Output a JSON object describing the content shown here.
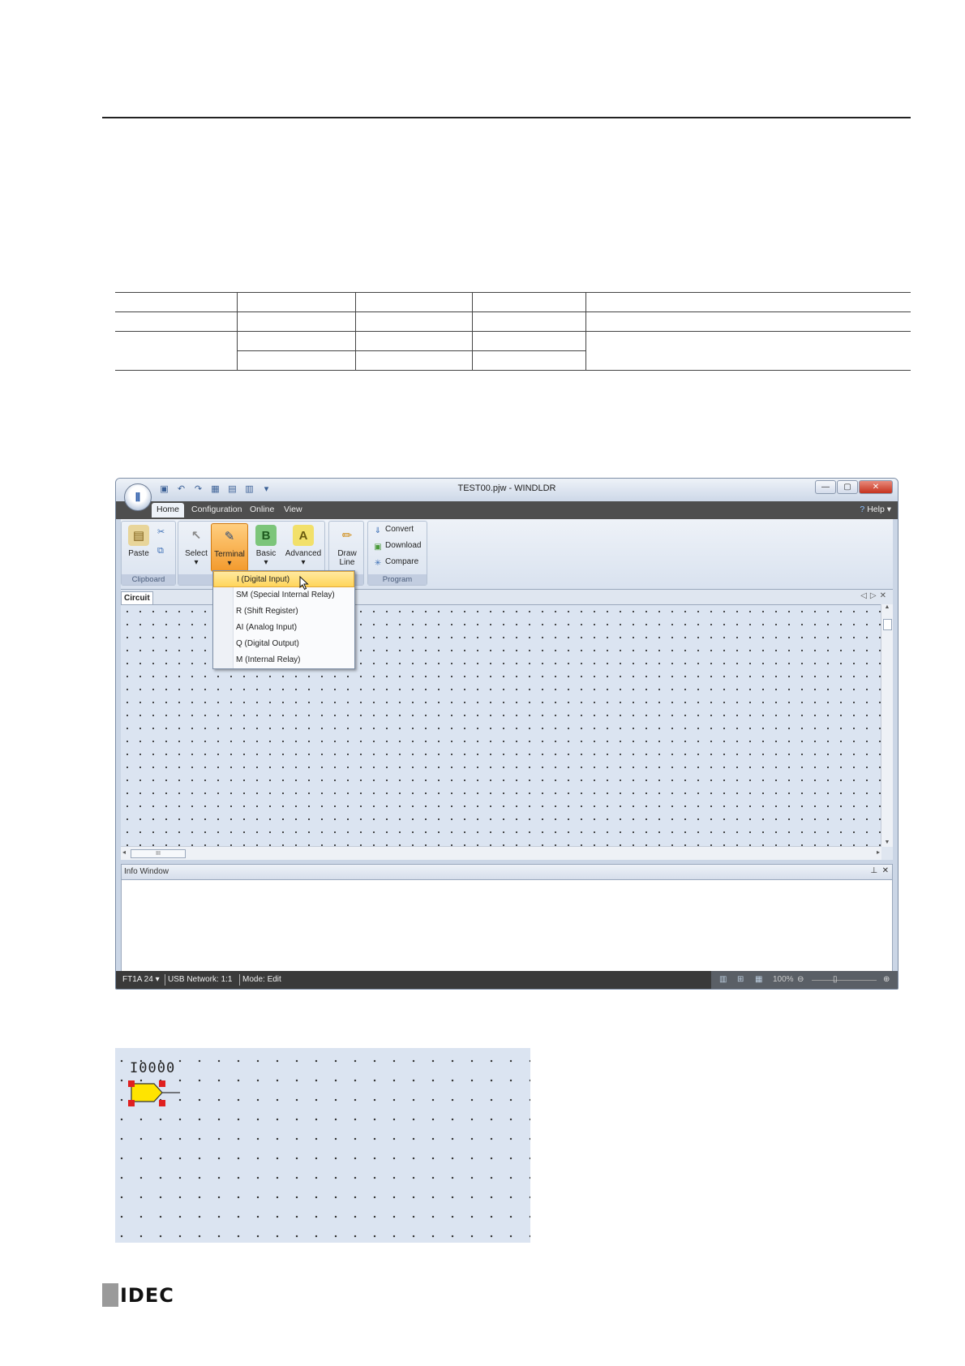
{
  "window": {
    "title": "TEST00.pjw - WINDLDR",
    "orb_label": "idec-orb",
    "menu_tabs": [
      "Home",
      "Configuration",
      "Online",
      "View"
    ],
    "help_label": "Help",
    "ribbon": {
      "clipboard": {
        "paste": "Paste",
        "group_label": "Clipboard"
      },
      "select": "Select",
      "terminal": "Terminal",
      "basic": "Basic",
      "advanced": "Advanced",
      "draw_line_1": "Draw",
      "draw_line_2": "Line",
      "program": {
        "convert": "Convert",
        "download": "Download",
        "compare": "Compare",
        "group_label": "Program"
      }
    },
    "document_tab": "Circuit",
    "info_window": "Info Window",
    "statusbar": {
      "plc": "FT1A 24",
      "connection": "USB  Network: 1:1",
      "mode": "Mode: Edit",
      "zoom": "100%"
    }
  },
  "terminal_menu": [
    "I (Digital Input)",
    "SM (Special Internal Relay)",
    "R (Shift Register)",
    "AI (Analog Input)",
    "Q (Digital Output)",
    "M (Internal Relay)"
  ],
  "figure2": {
    "element_label": "I0000"
  },
  "footer": {
    "logo": "IDEC"
  },
  "colors": {
    "ribbon_selected": "#f39a2d",
    "menu_highlight": "#ffd55a",
    "canvas": "#dbe4f1",
    "terminal_fill": "#ffe400",
    "handle": "#e02020"
  }
}
